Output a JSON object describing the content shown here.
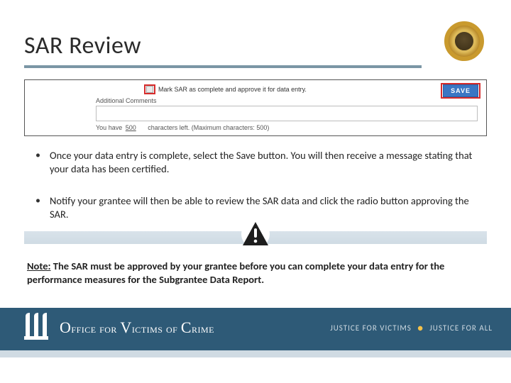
{
  "slide": {
    "title": "SAR Review"
  },
  "form": {
    "checkbox_label": "Mark SAR as complete and approve it for data entry.",
    "save_label": "SAVE",
    "additional_label": "Additional Comments",
    "chars_prefix": "You have",
    "chars_count": "500",
    "chars_suffix": "characters left.   (Maximum characters: 500)"
  },
  "bullets": [
    "Once your data entry is complete, select the Save button. You will then receive a message stating that your data has been certified.",
    "Notify your grantee will then be able to review the SAR data and click the radio button approving the SAR."
  ],
  "note": {
    "label": "Note:",
    "body": "The SAR must be approved by your grantee before you can complete your data entry for the performance measures for the Subgrantee Data Report."
  },
  "footer": {
    "org": "Office for Victims of Crime",
    "tag1": "JUSTICE FOR VICTIMS",
    "tag2": "JUSTICE FOR ALL"
  }
}
